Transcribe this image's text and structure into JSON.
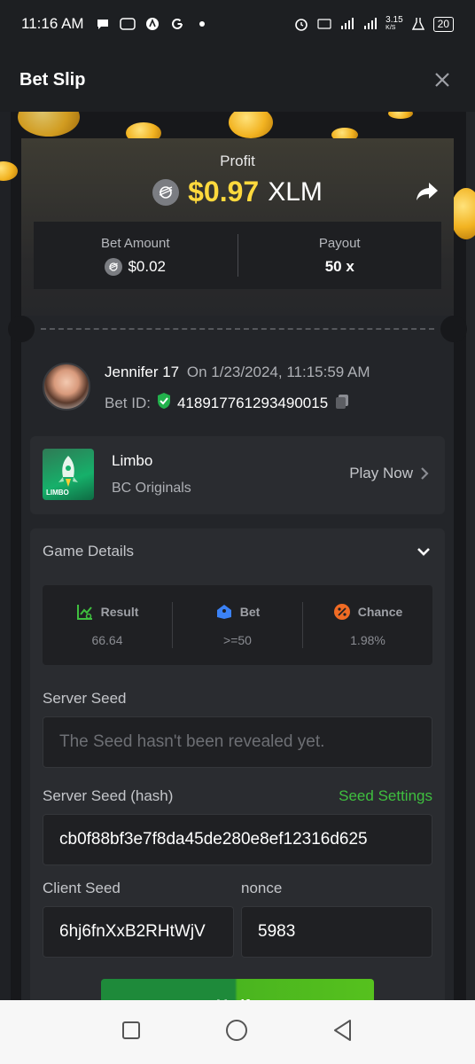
{
  "status_bar": {
    "time": "11:16 AM",
    "battery": "20",
    "net_speed": "3.15",
    "net_unit": "K/S"
  },
  "header": {
    "title": "Bet Slip"
  },
  "profit": {
    "label": "Profit",
    "amount": "$0.97",
    "currency": "XLM"
  },
  "bet": {
    "amount_label": "Bet Amount",
    "amount_value": "$0.02",
    "payout_label": "Payout",
    "payout_value": "50 x"
  },
  "user": {
    "name": "Jennifer 17",
    "on_text": "On 1/23/2024, 11:15:59 AM",
    "bet_id_label": "Bet ID:",
    "bet_id": "418917761293490015"
  },
  "game": {
    "name": "Limbo",
    "provider": "BC Originals",
    "play_label": "Play Now",
    "thumb_tag": "LIMBO"
  },
  "details": {
    "title": "Game Details",
    "stats": [
      {
        "label": "Result",
        "value": "66.64",
        "icon": "chart-icon",
        "color": "#3fbf3f"
      },
      {
        "label": "Bet",
        "value": ">=50",
        "icon": "tag-icon",
        "color": "#3b82f6"
      },
      {
        "label": "Chance",
        "value": "1.98%",
        "icon": "percent-icon",
        "color": "#f06b24"
      }
    ],
    "server_seed_label": "Server Seed",
    "server_seed_placeholder": "The Seed hasn't been revealed yet.",
    "server_seed_hash_label": "Server Seed (hash)",
    "seed_settings_label": "Seed Settings",
    "server_seed_hash": "cb0f88bf3e7f8da45de280e8ef12316d625",
    "client_seed_label": "Client Seed",
    "client_seed": "6hj6fnXxB2RHtWjV",
    "nonce_label": "nonce",
    "nonce": "5983",
    "verify_label": "Verify"
  },
  "colors": {
    "accent_yellow": "#ffd93d",
    "accent_green": "#3fbf3f",
    "background": "#17181b"
  }
}
